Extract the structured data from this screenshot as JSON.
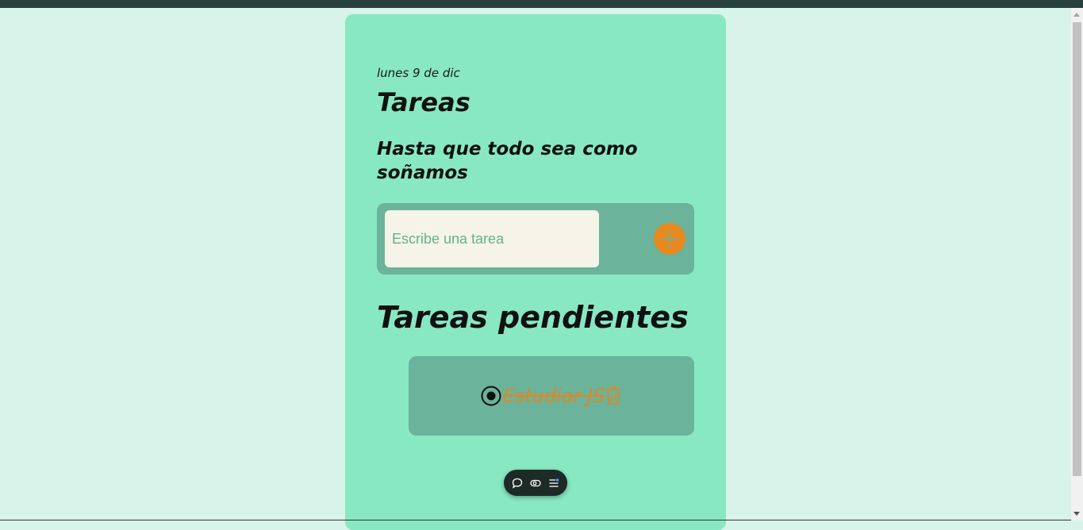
{
  "header": {
    "date": "lunes 9 de dic",
    "title": "Tareas",
    "subtitle": "Hasta que todo sea como soñamos"
  },
  "form": {
    "placeholder": "Escribe una tarea",
    "value": "",
    "add_icon": "plus-icon"
  },
  "pending": {
    "title": "Tareas pendientes",
    "tasks": [
      {
        "text": "Estudiar JS",
        "completed": true,
        "check_icon": "radio-checked-icon",
        "delete_icon": "trash-icon"
      }
    ]
  },
  "toolbar": {
    "icons": [
      "comment-icon",
      "eye-icon",
      "list-settings-icon"
    ]
  },
  "colors": {
    "page_bg": "#d8f3ea",
    "card_bg": "#88e8c2",
    "form_bg": "#6bb39a",
    "accent": "#e8891f",
    "input_bg": "#f6f4e8",
    "topbar": "#27403b"
  }
}
